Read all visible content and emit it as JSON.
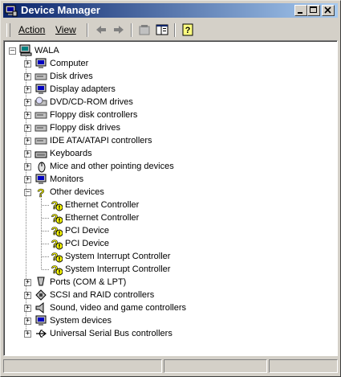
{
  "window": {
    "title": "Device Manager"
  },
  "menu": {
    "action": "Action",
    "view": "View"
  },
  "icons": {
    "app": "device-manager-icon",
    "back": "back-arrow-icon",
    "forward": "forward-arrow-icon",
    "properties": "properties-icon",
    "console": "console-tree-icon",
    "help": "help-icon"
  },
  "tree": {
    "root": "WALA",
    "categories": [
      {
        "label": "Computer",
        "icon": "computer-icon"
      },
      {
        "label": "Disk drives",
        "icon": "disk-drive-icon"
      },
      {
        "label": "Display adapters",
        "icon": "display-adapter-icon"
      },
      {
        "label": "DVD/CD-ROM drives",
        "icon": "cdrom-icon"
      },
      {
        "label": "Floppy disk controllers",
        "icon": "floppy-controller-icon"
      },
      {
        "label": "Floppy disk drives",
        "icon": "floppy-drive-icon"
      },
      {
        "label": "IDE ATA/ATAPI controllers",
        "icon": "ide-controller-icon"
      },
      {
        "label": "Keyboards",
        "icon": "keyboard-icon"
      },
      {
        "label": "Mice and other pointing devices",
        "icon": "mouse-icon"
      },
      {
        "label": "Monitors",
        "icon": "monitor-icon"
      },
      {
        "label": "Other devices",
        "icon": "unknown-device-icon"
      }
    ],
    "other_devices": [
      "Ethernet Controller",
      "Ethernet Controller",
      "PCI Device",
      "PCI Device",
      "System Interrupt Controller",
      "System Interrupt Controller"
    ],
    "categories_after": [
      {
        "label": "Ports (COM & LPT)",
        "icon": "port-icon"
      },
      {
        "label": "SCSI and RAID controllers",
        "icon": "scsi-icon"
      },
      {
        "label": "Sound, video and game controllers",
        "icon": "sound-icon"
      },
      {
        "label": "System devices",
        "icon": "system-device-icon"
      },
      {
        "label": "Universal Serial Bus controllers",
        "icon": "usb-icon"
      }
    ]
  },
  "colors": {
    "title_start": "#0a246a",
    "title_end": "#a6caf0",
    "warning": "#ffff00"
  }
}
